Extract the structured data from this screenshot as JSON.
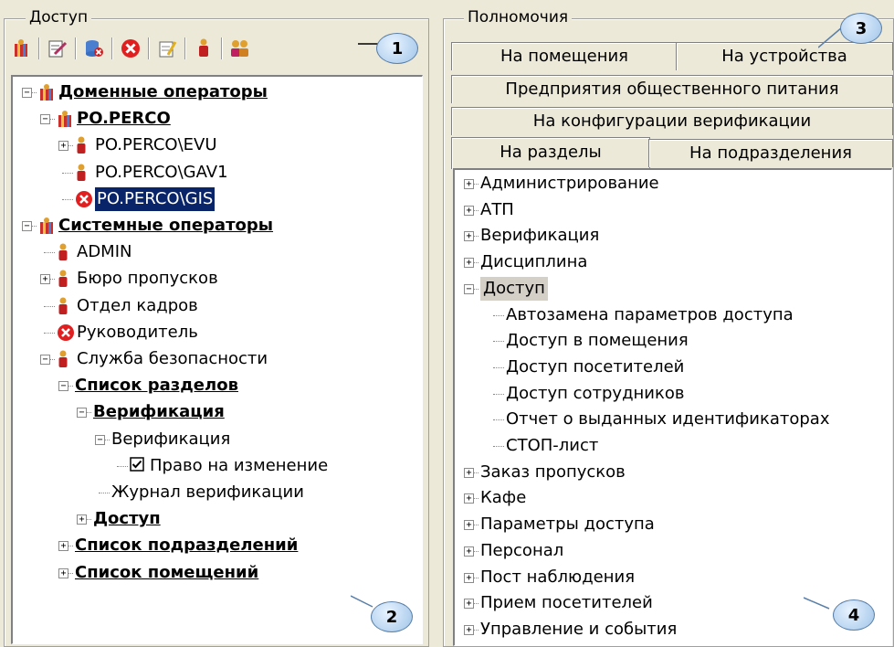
{
  "left_panel": {
    "title": "Доступ",
    "toolbar_icons": [
      "add-group-icon",
      "edit-icon",
      "delete-db-icon",
      "stop-icon",
      "properties-icon",
      "user-icon",
      "users-icon"
    ],
    "tree": [
      {
        "label": "Доменные операторы",
        "bold": true,
        "icon": "group-icon",
        "level": 0,
        "expander": "-"
      },
      {
        "label": "PO.PERCO",
        "bold": true,
        "icon": "group-icon",
        "level": 1,
        "expander": "-"
      },
      {
        "label": "PO.PERCO\\EVU",
        "bold": false,
        "icon": "user-icon",
        "level": 2,
        "expander": "+"
      },
      {
        "label": "PO.PERCO\\GAV1",
        "bold": false,
        "icon": "user-icon",
        "level": 2,
        "expander": ""
      },
      {
        "label": "PO.PERCO\\GIS",
        "bold": false,
        "icon": "stop-icon",
        "level": 2,
        "expander": "",
        "selected": true
      },
      {
        "label": "Системные операторы",
        "bold": true,
        "icon": "group-icon",
        "level": 0,
        "expander": "-"
      },
      {
        "label": "ADMIN",
        "bold": false,
        "icon": "user-icon",
        "level": 1,
        "expander": ""
      },
      {
        "label": "Бюро пропусков",
        "bold": false,
        "icon": "user-icon",
        "level": 1,
        "expander": "+"
      },
      {
        "label": "Отдел кадров",
        "bold": false,
        "icon": "user-icon",
        "level": 1,
        "expander": ""
      },
      {
        "label": "Руководитель",
        "bold": false,
        "icon": "stop-icon",
        "level": 1,
        "expander": ""
      },
      {
        "label": "Служба безопасности",
        "bold": false,
        "icon": "user-icon",
        "level": 1,
        "expander": "-"
      },
      {
        "label": "Список разделов",
        "bold": true,
        "icon": "",
        "level": 2,
        "expander": "-"
      },
      {
        "label": "Верификация",
        "bold": true,
        "icon": "",
        "level": 3,
        "expander": "-"
      },
      {
        "label": "Верификация",
        "bold": false,
        "icon": "",
        "level": 4,
        "expander": "-"
      },
      {
        "label": "Право на изменение",
        "bold": false,
        "icon": "checkbox",
        "level": 5,
        "expander": ""
      },
      {
        "label": "Журнал верификации",
        "bold": false,
        "icon": "",
        "level": 4,
        "expander": ""
      },
      {
        "label": "Доступ",
        "bold": true,
        "icon": "",
        "level": 3,
        "expander": "+"
      },
      {
        "label": "Список подразделений",
        "bold": true,
        "icon": "",
        "level": 2,
        "expander": "+"
      },
      {
        "label": "Список помещений",
        "bold": true,
        "icon": "",
        "level": 2,
        "expander": "+"
      }
    ]
  },
  "right_panel": {
    "title": "Полномочия",
    "tabs_row1": [
      "На помещения",
      "На устройства"
    ],
    "tabs_row2": [
      "Предприятия общественного питания"
    ],
    "tabs_row3": [
      "На конфигурации верификации"
    ],
    "tabs_row4": [
      "На разделы",
      "На подразделения"
    ],
    "tree": [
      {
        "label": "Администрирование",
        "level": 0,
        "expander": "+"
      },
      {
        "label": "АТП",
        "level": 0,
        "expander": "+"
      },
      {
        "label": "Верификация",
        "level": 0,
        "expander": "+"
      },
      {
        "label": "Дисциплина",
        "level": 0,
        "expander": "+"
      },
      {
        "label": "Доступ",
        "level": 0,
        "expander": "-",
        "highlight": true
      },
      {
        "label": "Автозамена параметров доступа",
        "level": 1,
        "expander": ""
      },
      {
        "label": "Доступ в помещения",
        "level": 1,
        "expander": ""
      },
      {
        "label": "Доступ посетителей",
        "level": 1,
        "expander": ""
      },
      {
        "label": "Доступ сотрудников",
        "level": 1,
        "expander": ""
      },
      {
        "label": "Отчет о выданных идентификаторах",
        "level": 1,
        "expander": ""
      },
      {
        "label": "СТОП-лист",
        "level": 1,
        "expander": ""
      },
      {
        "label": "Заказ пропусков",
        "level": 0,
        "expander": "+"
      },
      {
        "label": "Кафе",
        "level": 0,
        "expander": "+"
      },
      {
        "label": "Параметры доступа",
        "level": 0,
        "expander": "+"
      },
      {
        "label": "Персонал",
        "level": 0,
        "expander": "+"
      },
      {
        "label": "Пост наблюдения",
        "level": 0,
        "expander": "+"
      },
      {
        "label": "Прием посетителей",
        "level": 0,
        "expander": "+"
      },
      {
        "label": "Управление и события",
        "level": 0,
        "expander": "+"
      }
    ]
  },
  "callouts": [
    "1",
    "2",
    "3",
    "4"
  ]
}
